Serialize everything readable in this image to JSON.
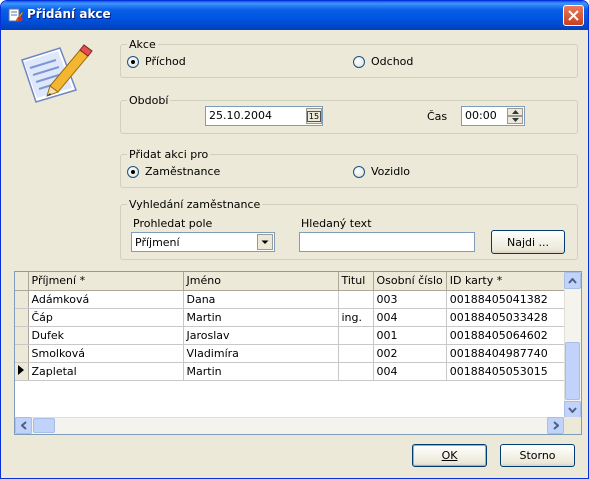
{
  "window": {
    "title": "Přidání akce"
  },
  "akce": {
    "legend": "Akce",
    "options": [
      {
        "label": "Příchod",
        "selected": true
      },
      {
        "label": "Odchod",
        "selected": false
      }
    ]
  },
  "obdobi": {
    "legend": "Období",
    "date": "25.10.2004",
    "calendar_button": "15",
    "cas_label": "Čas",
    "time": "00:00"
  },
  "pridat_pro": {
    "legend": "Přidat akci pro",
    "options": [
      {
        "label": "Zaměstnance",
        "selected": true
      },
      {
        "label": "Vozidlo",
        "selected": false
      }
    ]
  },
  "vyhledani": {
    "legend": "Vyhledání zaměstnance",
    "pole_label": "Prohledat pole",
    "pole_value": "Příjmení",
    "text_label": "Hledaný text",
    "text_value": "",
    "najdi_button": "Najdi ..."
  },
  "table": {
    "columns": [
      "Příjmení *",
      "Jméno",
      "Titul",
      "Osobní číslo",
      "ID karty *"
    ],
    "rows": [
      [
        "Adámková",
        "Dana",
        "",
        "003",
        "00188405041382"
      ],
      [
        "Čáp",
        "Martin",
        "ing.",
        "004",
        "00188405033428"
      ],
      [
        "Dufek",
        "Jaroslav",
        "",
        "001",
        "00188405064602"
      ],
      [
        "Smolková",
        "Vladimíra",
        "",
        "002",
        "00188404987740"
      ],
      [
        "Zapletal",
        "Martin",
        "",
        "004",
        "00188405053015"
      ]
    ],
    "current_row": 4
  },
  "buttons": {
    "ok": "OK",
    "storno": "Storno"
  },
  "colors": {
    "title_bar": "#0054e3",
    "face": "#ece9d8",
    "close": "#c8401f"
  }
}
